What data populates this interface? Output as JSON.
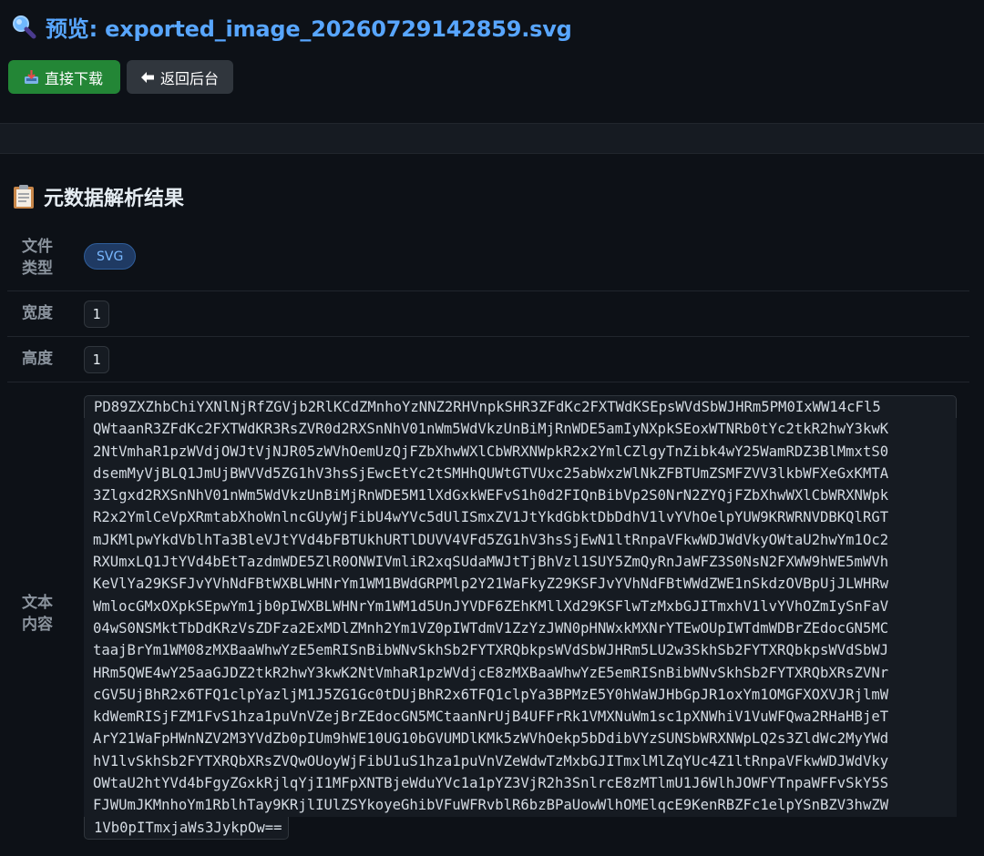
{
  "header": {
    "title": "预览: exported_image_20260729142859.svg",
    "title_icon": "magnifier-icon",
    "accent_color": "#58a6ff"
  },
  "buttons": {
    "download_label": "直接下载",
    "download_icon": "inbox-tray-icon",
    "back_label": "返回后台",
    "back_icon": "left-arrow-icon"
  },
  "section": {
    "title": "元数据解析结果",
    "icon": "clipboard-icon"
  },
  "metadata": {
    "file_type_label": "文件\n类型",
    "file_type_value": "SVG",
    "width_label": "宽度",
    "width_value": "1",
    "height_label": "高度",
    "height_value": "1",
    "text_label": "文本\n内容",
    "text_lines": [
      "PD89ZXZhbChiYXNlNjRfZGVjb2RlKCdZMnhoYzNNZ2RHVnpkSHR3ZFdKc2FXTWdKSEpsWVdSbWJHRm5PM0IxWW14cFl5",
      "QWtaanR3ZFdKc2FXTWdKR3RsZVR0d2RXSnNhV01nWm5WdVkzUnBiMjRnWDE5amIyNXpkSEoxWTNRb0tYc2tkR2hwY3kwK",
      "2NtVmhaR1pzWVdjOWJtVjNJR05zWVhOemUzQjFZbXhwWXlCbWRXNWpkR2x2YmlCZlgyTnZibk4wY25WamRDZ3BlMmxtS0",
      "dsemMyVjBLQ1JmUjBWVVd5ZG1hV3hsSjEwcEtYc2tSMHhQUWtGTVUxc25abWxzWlNkZFBTUmZSMFZVV3lkbWFXeGxKMTA",
      "3Zlgxd2RXSnNhV01nWm5WdVkzUnBiMjRnWDE5M1lXdGxkWEFvS1h0d2FIQnBibVp2S0NrN2ZYQjFZbXhwWXlCbWRXNWpk",
      "R2x2YmlCeVpXRmtabXhoWnlncGUyWjFibU4wYVc5dUlISmxZV1JtYkdGbktDbDdhV1lvYVhOelpYUW9KRWRNVDBKQlRGT",
      "mJKMlpwYkdVblhTa3BleVJtYVd4bFBTUkhURTlDUVV4VFd5ZG1hV3hsSjEwN1ltRnpaVFkwWDJWdVkyOWtaU2hwYm1Oc2",
      "RXUmxLQ1JtYVd4bEtTazdmWDE5ZlR0ONWIVmliR2xqSUdaMWJtTjBhVzl1SUY5ZmQyRnJaWFZ3S0NsN2FXWW9hWE5mWVh",
      "KeVlYa29KSFJvYVhNdFBtWXBLWHNrYm1WM1BWdGRPMlp2Y21WaFkyZ29KSFJvYVhNdFBtWWdZWE1nSkdzOVBpUjJLWHRw",
      "WmlocGMxOXpkSEpwYm1jb0pIWXBLWHNrYm1WM1d5UnJYVDF6ZEhKMllXd29KSFlwTzMxbGJITmxhV1lvYVhOZmIySnFaV",
      "04wS0NSMktTbDdKRzVsZDFza2ExMDlZMnh2Ym1VZ0pIWTdmV1ZzYzJWN0pHNWxkMXNrYTEwOUpIWTdmWDBrZEdocGN5MC",
      "taajBrYm1WM08zMXBaaWhwYzE5emRISnBibWNvSkhSb2FYTXRQbkpsWVdSbWJHRm5LU2w3SkhSb2FYTXRQbkpsWVdSbWJ",
      "HRm5QWE4wY25aaGJDZ2tkR2hwY3kwK2NtVmhaR1pzWVdjcE8zMXBaaWhwYzE5emRISnBibWNvSkhSb2FYTXRQbXRsZVNr",
      "cGV5UjBhR2x6TFQ1clpYazljM1J5ZG1Gc0tDUjBhR2x6TFQ1clpYa3BPMzE5Y0hWaWJHbGpJR1oxYm1OMGFXOXVJRjlmW",
      "kdWemRISjFZM1FvS1hza1puVnVZejBrZEdocGN5MCtaanNrUjB4UFFrRk1VMXNuWm1sc1pXNWhiV1VuWFQwa2RHaHBjeT",
      "ArY21WaFpHWnNZV2M3YVdZb0pIUm9hWE10UG10bGVUMDlKMk5zWVhOekp5bDdibVYzSUNSbWRXNWpLQ2s3ZldWc2MyYWd",
      "hV1lvSkhSb2FYTXRQbXRsZVQwOUoyWjFibU1uS1hza1puVnVZeWdwTzMxbGJITmxlMlZqYUc4Z1ltRnpaVFkwWDJWdVky",
      "OWtaU2htYVd4bFgyZGxkRjlqYjI1MFpXNTBjeWduYVc1a1pYZ3VjR2h3SnlrcE8zMTlmU1J6WlhJOWFYTnpaWFFvSkY5S",
      "FJWUmJKMnhoYm1RblhTay9KRjlIUlZSYkoyeGhibVFuWFRvblR6bzBPaUowWlhOMElqcE9KenRBZFc1elpYSnBZV3hwZW",
      "1Vb0pITmxjaWs3JykpOw=="
    ]
  }
}
